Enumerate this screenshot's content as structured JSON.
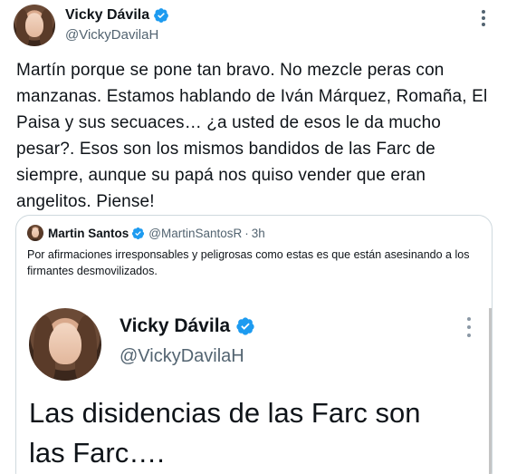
{
  "tweet": {
    "author": {
      "display_name": "Vicky Dávila",
      "handle": "@VickyDavilaH",
      "verified": true
    },
    "text": "Martín porque se pone tan bravo. No mezcle peras con manzanas. Estamos hablando de Iván Márquez, Romaña, El Paisa y sus secuaces… ¿a usted de esos le da mucho pesar?. Esos son los mismos bandidos de las Farc de siempre, aunque su papá nos quiso vender que eran angelitos. Piense!",
    "more_icon": "more-horizontal-icon"
  },
  "quoted_tweet": {
    "author": {
      "display_name": "Martin Santos",
      "handle": "@MartinSantosR",
      "verified": true
    },
    "separator": "·",
    "time": "3h",
    "text": "Por afirmaciones irresponsables y peligrosas como estas es que están asesinando a los firmantes desmovilizados.",
    "embedded_screenshot": {
      "display_name": "Vicky Dávila",
      "handle": "@VickyDavilaH",
      "verified": true,
      "text": "Las disidencias de las Farc son las Farc…."
    }
  },
  "colors": {
    "text_primary": "#0f1419",
    "text_secondary": "#536471",
    "verified_blue": "#1d9bf0",
    "border": "#cfd9de"
  }
}
